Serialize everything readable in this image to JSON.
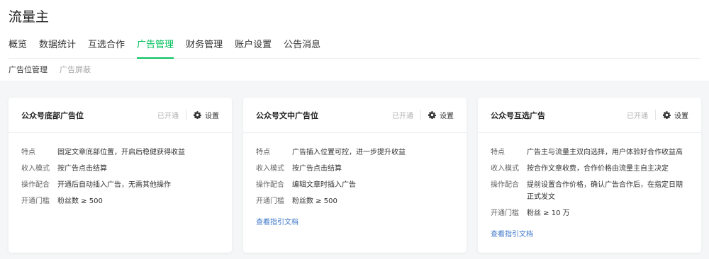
{
  "app": {
    "title": "流量主"
  },
  "main_nav": [
    {
      "label": "概览",
      "active": false
    },
    {
      "label": "数据统计",
      "active": false
    },
    {
      "label": "互选合作",
      "active": false
    },
    {
      "label": "广告管理",
      "active": true
    },
    {
      "label": "财务管理",
      "active": false
    },
    {
      "label": "账户设置",
      "active": false
    },
    {
      "label": "公告消息",
      "active": false
    }
  ],
  "sub_nav": [
    {
      "label": "广告位管理",
      "active": true
    },
    {
      "label": "广告屏蔽",
      "active": false
    }
  ],
  "colors": {
    "accent": "#07c160",
    "link": "#3f77c8",
    "muted": "#b2b2b2"
  },
  "cards": [
    {
      "title": "公众号底部广告位",
      "status": "已开通",
      "setting_label": "设置",
      "rows": [
        {
          "label": "特点",
          "value": "固定文章底部位置，开启后稳健获得收益"
        },
        {
          "label": "收入模式",
          "value": "按广告点击结算"
        },
        {
          "label": "操作配合",
          "value": "开通后自动插入广告，无需其他操作"
        },
        {
          "label": "开通门槛",
          "value": "粉丝数 ≥ 500"
        }
      ],
      "link": ""
    },
    {
      "title": "公众号文中广告位",
      "status": "已开通",
      "setting_label": "设置",
      "rows": [
        {
          "label": "特点",
          "value": "广告插入位置可控，进一步提升收益"
        },
        {
          "label": "收入模式",
          "value": "按广告点击结算"
        },
        {
          "label": "操作配合",
          "value": "编辑文章时插入广告"
        },
        {
          "label": "开通门槛",
          "value": "粉丝数 ≥ 500"
        }
      ],
      "link": "查看指引文档"
    },
    {
      "title": "公众号互选广告",
      "status": "已开通",
      "setting_label": "设置",
      "rows": [
        {
          "label": "特点",
          "value": "广告主与流量主双向选择，用户体验好合作收益高"
        },
        {
          "label": "收入模式",
          "value": "按合作文章收费，合作价格由流量主自主决定"
        },
        {
          "label": "操作配合",
          "value": "提前设置合作价格，确认广告合作后，在指定日期正式发文"
        },
        {
          "label": "开通门槛",
          "value": "粉丝 ≥ 10 万"
        }
      ],
      "link": "查看指引文档"
    }
  ]
}
